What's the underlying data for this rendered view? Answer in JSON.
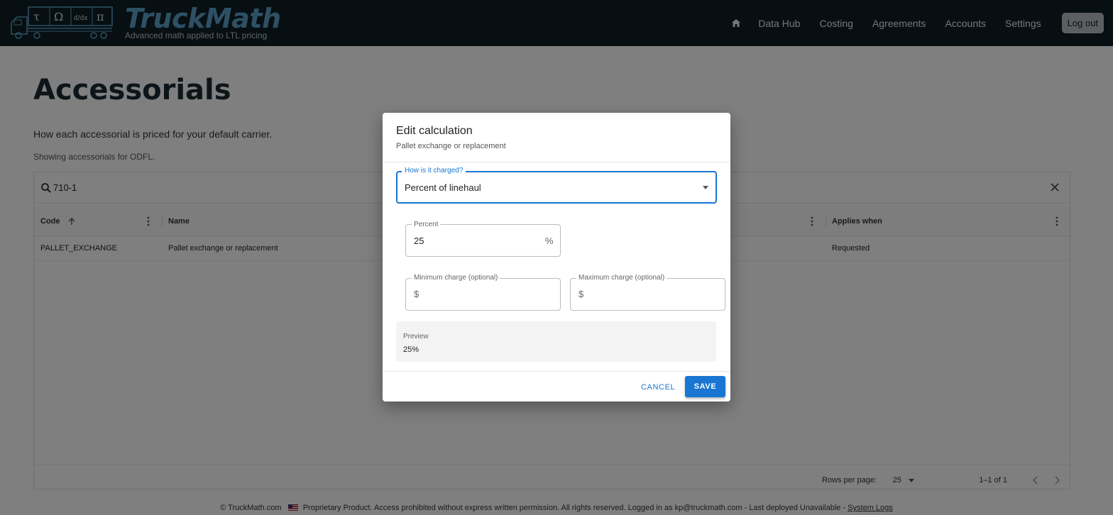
{
  "header": {
    "brand": "TruckMath",
    "tagline": "Advanced math applied to LTL pricing",
    "logo_glyphs": [
      "τ",
      "Ω",
      "d/dx",
      "π"
    ],
    "nav": [
      "Data Hub",
      "Costing",
      "Agreements",
      "Accounts",
      "Settings"
    ],
    "logout": "Log out"
  },
  "page": {
    "title": "Accessorials",
    "subtitle": "How each accessorial is priced for your default carrier.",
    "carrier_note": "Showing accessorials for ODFL."
  },
  "grid": {
    "search_value": "710-1",
    "columns": [
      "Code",
      "Name",
      "Applies when"
    ],
    "rows": [
      {
        "code": "PALLET_EXCHANGE",
        "name": "Pallet exchange or replacement",
        "applies_when": "Requested"
      }
    ],
    "rows_per_page_label": "Rows per page:",
    "rows_per_page": "25",
    "page_range": "1–1 of 1"
  },
  "footer": {
    "copyright": "© TruckMath.com",
    "notice": "Proprietary Product. Access prohibited without express written permission. All rights reserved. Logged in as kp@truckmath.com - Last deployed Unavailable -",
    "link": "System Logs"
  },
  "dialog": {
    "title": "Edit calculation",
    "subtitle": "Pallet exchange or replacement",
    "charge_label": "How is it charged?",
    "charge_value": "Percent of linehaul",
    "percent_label": "Percent",
    "percent_value": "25",
    "percent_unit": "%",
    "min_label": "Minimum charge (optional)",
    "max_label": "Maximum charge (optional)",
    "currency": "$",
    "preview_label": "Preview",
    "preview_value": "25%",
    "cancel": "CANCEL",
    "save": "SAVE"
  },
  "colors": {
    "header_bg": "#0f1e24",
    "brand": "#5aa0c8",
    "primary": "#1976d2"
  }
}
